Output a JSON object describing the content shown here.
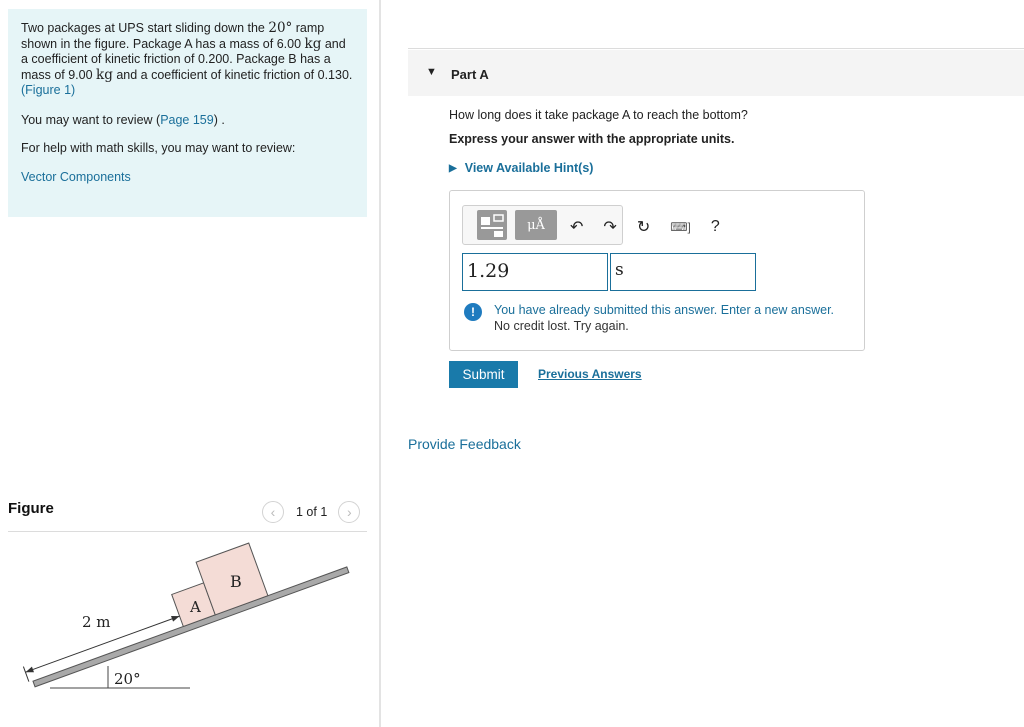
{
  "problem": {
    "text_part1": "Two packages at UPS start sliding down the ",
    "angle": "20°",
    "text_part2": " ramp shown in the figure. Package A has a mass of 6.00 ",
    "unit_kg_1": "kg",
    "text_part3": " and a coefficient of kinetic friction of 0.200. Package B has a mass of 9.00 ",
    "unit_kg_2": "kg",
    "text_part4": " and a coefficient of kinetic friction of 0.130.",
    "figure_link": "(Figure 1)",
    "review_prefix": "You may want to review (",
    "review_link": "Page 159",
    "review_suffix": ") .",
    "math_help": "For help with math skills, you may want to review:",
    "vector_link": "Vector Components"
  },
  "figure": {
    "title": "Figure",
    "prev_icon": "chevron-left-icon",
    "next_icon": "chevron-right-icon",
    "page_count": "1 of 1",
    "label_distance": "2 m",
    "label_angle": "20°",
    "label_a": "A",
    "label_b": "B"
  },
  "part": {
    "title": "Part A",
    "question": "How long does it take package A to reach the bottom?",
    "instruction": "Express your answer with the appropriate units.",
    "hints": "View Available Hint(s)"
  },
  "toolbar": {
    "units_button": "μÅ",
    "icons": [
      "templates-icon",
      "units-icon",
      "undo-icon",
      "redo-icon",
      "reset-icon",
      "keyboard-icon",
      "help-icon"
    ],
    "help": "?"
  },
  "answer": {
    "value": "1.29",
    "unit": "s"
  },
  "feedback": {
    "line1": "You have already submitted this answer. Enter a new answer.",
    "line2": "No credit lost. Try again."
  },
  "actions": {
    "submit": "Submit",
    "previous": "Previous Answers",
    "provide_feedback": "Provide Feedback"
  },
  "colors": {
    "accent": "#197aaa",
    "problem_bg": "#e6f5f7",
    "package_fill": "#f4dcd6"
  }
}
